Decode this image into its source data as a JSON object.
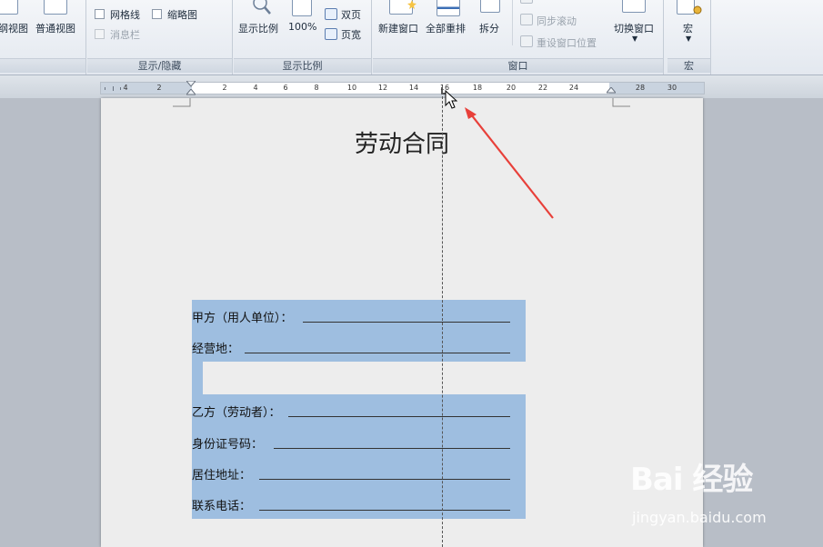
{
  "ribbon": {
    "views": {
      "draft_view_partial": "纲视图",
      "normal_view": "普通视图"
    },
    "show_hide": {
      "gridlines": "网格线",
      "thumbnails": "缩略图",
      "message_bar": "消息栏",
      "group_label": "显示/隐藏"
    },
    "zoom": {
      "zoom_label": "显示比例",
      "hundred_percent": "100%",
      "two_pages": "双页",
      "page_width": "页宽",
      "group_label": "显示比例"
    },
    "window": {
      "new_window": "新建窗口",
      "arrange_all": "全部重排",
      "split": "拆分",
      "sync_scroll": "同步滚动",
      "reset_window_position": "重设窗口位置",
      "switch_windows": "切换窗口",
      "group_label": "窗口"
    },
    "macros": {
      "macro": "宏",
      "group_label": "宏"
    }
  },
  "ruler": {
    "numbers": [
      "4",
      "2",
      "2",
      "4",
      "6",
      "8",
      "10",
      "12",
      "14",
      "16",
      "18",
      "20",
      "22",
      "24",
      "28",
      "30"
    ]
  },
  "document": {
    "title": "劳动合同",
    "fields": [
      {
        "label": "甲方（用人单位）："
      },
      {
        "label": "经营地："
      },
      {
        "label": "乙方（劳动者）："
      },
      {
        "label": "身份证号码："
      },
      {
        "label": "居住地址："
      },
      {
        "label": "联系电话："
      }
    ],
    "selection_color": "#9ebee0"
  },
  "annotation": {
    "arrow_color": "#e8403a"
  },
  "watermark": {
    "logo": "Bai 经验",
    "url": "jingyan.baidu.com"
  }
}
